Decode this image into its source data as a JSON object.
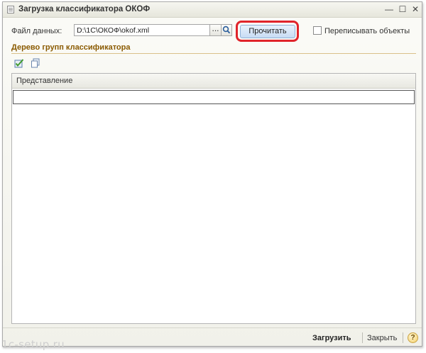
{
  "window": {
    "title": "Загрузка классификатора ОКОФ",
    "controls": {
      "minimize": "—",
      "maximize": "☐",
      "close": "✕"
    }
  },
  "form": {
    "file_label": "Файл данных:",
    "file_value": "D:\\1C\\ОКОФ\\okof.xml",
    "browse_label": "...",
    "read_button": "Прочитать",
    "overwrite_label": "Переписывать объекты",
    "overwrite_checked": false
  },
  "tree": {
    "group_title": "Дерево групп классификатора",
    "column_header": "Представление",
    "rows": [
      ""
    ]
  },
  "footer": {
    "load_button": "Загрузить",
    "close_button": "Закрыть",
    "help_button": "?"
  },
  "watermark": "1c-setup.ru",
  "colors": {
    "highlight": "#e0242b",
    "group_title": "#8a5a00",
    "read_button_bg": "#c7dcf4"
  }
}
